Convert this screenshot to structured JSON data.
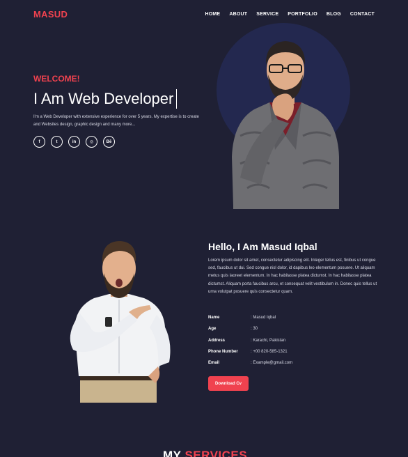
{
  "nav": {
    "logo": "MASUD",
    "items": [
      "HOME",
      "ABOUT",
      "SERVICE",
      "PORTFOLIO",
      "BLOG",
      "CONTACT"
    ]
  },
  "hero": {
    "welcome": "WELCOME!",
    "headline": "I Am Web Developer",
    "description": "I'm a Web Developer with extensive experience for over 5 years. My expertise is to create and Websites design, graphic design and many more...",
    "socials": [
      {
        "icon": "facebook-icon",
        "glyph": "f"
      },
      {
        "icon": "twitter-icon",
        "glyph": "t"
      },
      {
        "icon": "linkedin-icon",
        "glyph": "in"
      },
      {
        "icon": "instagram-icon",
        "glyph": "◎"
      },
      {
        "icon": "behance-icon",
        "glyph": "Bē"
      }
    ]
  },
  "about": {
    "title": "Hello, I Am Masud Iqbal",
    "text": "Lorem ipsum dolor sit amet, consectetur adipiscing elit. Integer tellus est, finibus ut congue sed, faucibus ut dui. Sed congue nisl dolor, id dapibus leo elementum posuere. Ut aliquam metus quis laoreet elementum. In hac habitasse platea dictumst. In hac habitasse platea dictumst. Aliquam porta faucibus arcu, et consequat velit vestibulum in. Donec quis tellus ut urna volutpat posuere quis consectetur quam.",
    "info": [
      {
        "label": "Name",
        "value": ": Masud Iqbal"
      },
      {
        "label": "Age",
        "value": ": 30"
      },
      {
        "label": "Address",
        "value": ": Karachi, Pakistan"
      },
      {
        "label": "Phone Number",
        "value": ": +00 820-585-1321"
      },
      {
        "label": "Email",
        "value": ": Example@gmail.com"
      }
    ],
    "button": "Download Cv"
  },
  "services": {
    "title_main": "MY",
    "title_accent": "SERVICES"
  },
  "colors": {
    "background": "#1f2034",
    "accent": "#f0424f",
    "circle": "#23284f"
  }
}
